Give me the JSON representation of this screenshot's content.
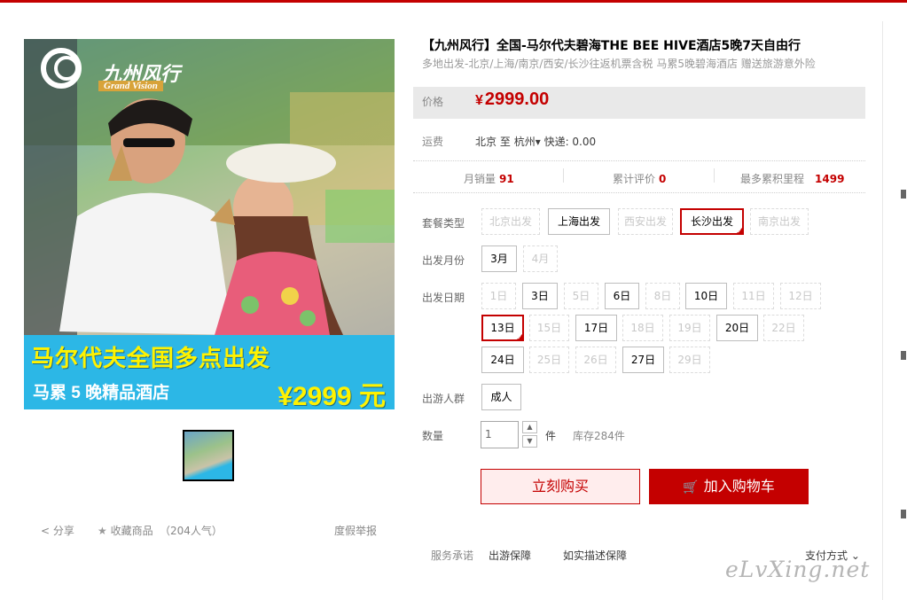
{
  "colors": {
    "accent": "#c40000",
    "banner": "#2cb7e6",
    "banner_text": "#fff200"
  },
  "main_image": {
    "logo_cn": "九州风行",
    "logo_en": "Grand Vision",
    "banner_title": "马尔代夫全国多点出发",
    "banner_sub": "马累 5 晚精品酒店",
    "banner_price": "¥2999 元"
  },
  "share": {
    "share_label": "分享",
    "favorite_label": "收藏商品",
    "popularity": "（204人气）",
    "report_label": "度假举报"
  },
  "product": {
    "title": "【九州风行】全国-马尔代夫碧海THE BEE HIVE酒店5晚7天自由行",
    "subtitle": "多地出发-北京/上海/南京/西安/长沙往返机票含税 马累5晚碧海酒店 赠送旅游意外险"
  },
  "price": {
    "label": "价格",
    "currency": "¥",
    "value": "2999.00"
  },
  "shipping": {
    "label": "运费",
    "from": "北京",
    "to_word": "至",
    "to": "杭州",
    "method": "快递: 0.00"
  },
  "stats": {
    "monthly_sales_label": "月销量",
    "monthly_sales": "91",
    "reviews_label": "累计评价",
    "reviews": "0",
    "mileage_label": "最多累积里程",
    "mileage": "1499"
  },
  "package": {
    "label": "套餐类型",
    "options": [
      "北京出发",
      "上海出发",
      "西安出发",
      "长沙出发",
      "南京出发"
    ],
    "selected": "长沙出发"
  },
  "month": {
    "label": "出发月份",
    "options": [
      "3月",
      "4月"
    ]
  },
  "dates": {
    "label": "出发日期",
    "options": [
      "1日",
      "3日",
      "5日",
      "6日",
      "8日",
      "10日",
      "11日",
      "12日",
      "13日",
      "15日",
      "17日",
      "18日",
      "19日",
      "20日",
      "22日",
      "24日",
      "25日",
      "26日",
      "27日",
      "29日"
    ],
    "selected": "13日"
  },
  "crowd": {
    "label": "出游人群",
    "options": [
      "成人"
    ]
  },
  "quantity": {
    "label": "数量",
    "value": "1",
    "unit": "件",
    "stock": "库存284件"
  },
  "actions": {
    "buy_now": "立刻购买",
    "add_to_cart": "加入购物车"
  },
  "service": {
    "label": "服务承诺",
    "items": [
      "出游保障",
      "如实描述保障"
    ],
    "payment": "支付方式"
  },
  "watermark": "eLvXing.net"
}
